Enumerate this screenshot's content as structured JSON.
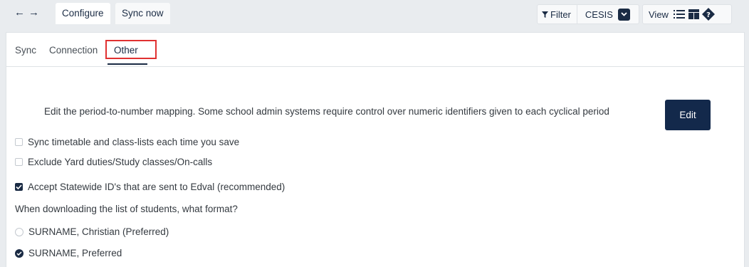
{
  "topbar": {
    "back_icon": "arrow-left-icon",
    "forward_icon": "arrow-right-icon",
    "tabs": [
      {
        "label": "Configure",
        "active": true
      },
      {
        "label": "Sync now",
        "active": false
      }
    ],
    "filter_label": "Filter",
    "filter_value": "CESIS",
    "view_label": "View"
  },
  "subtabs": [
    {
      "label": "Sync",
      "active": false
    },
    {
      "label": "Connection",
      "active": false
    },
    {
      "label": "Other",
      "active": true
    }
  ],
  "content": {
    "description": "Edit the period-to-number mapping. Some school admin systems require control over numeric identifiers given to each cyclical period",
    "edit_label": "Edit",
    "checkboxes": [
      {
        "label": "Sync timetable and class-lists each time you save",
        "checked": false
      },
      {
        "label": "Exclude Yard duties/Study classes/On-calls",
        "checked": false
      },
      {
        "label": "Accept Statewide ID's that are sent to Edval (recommended)",
        "checked": true
      }
    ],
    "format_question": "When downloading the list of students, what format?",
    "format_options": [
      {
        "label": "SURNAME, Christian (Preferred)",
        "checked": false
      },
      {
        "label": "SURNAME, Preferred",
        "checked": true
      }
    ]
  },
  "colors": {
    "accent": "#1a2b44",
    "primary_button": "#13294b",
    "highlight": "#e03131",
    "background": "#e9ecef"
  }
}
